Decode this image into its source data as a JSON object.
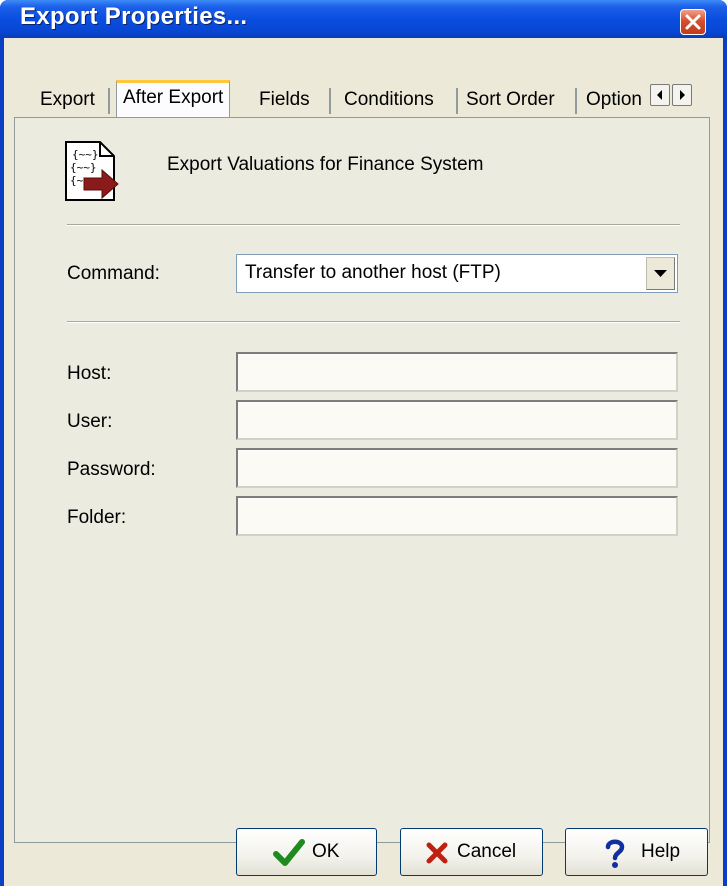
{
  "window": {
    "title": "Export Properties..."
  },
  "tabs": [
    "Export",
    "After Export",
    "Fields",
    "Conditions",
    "Sort Order",
    "Option"
  ],
  "active_tab": "After Export",
  "description": "Export Valuations for Finance System",
  "command": {
    "label": "Command:",
    "value": "Transfer to another host (FTP)"
  },
  "fields": {
    "host": {
      "label": "Host:",
      "value": ""
    },
    "user": {
      "label": "User:",
      "value": ""
    },
    "password": {
      "label": "Password:",
      "value": ""
    },
    "folder": {
      "label": "Folder:",
      "value": ""
    }
  },
  "buttons": {
    "ok": "OK",
    "cancel": "Cancel",
    "help": "Help"
  },
  "icons": [
    "close-icon",
    "document-export-icon",
    "chevron-down-icon",
    "scroll-left-icon",
    "scroll-right-icon",
    "checkmark-icon",
    "x-icon",
    "question-icon"
  ],
  "colors": {
    "titlebar": "#0a4ee0",
    "dialog_bg": "#ece9d8",
    "ok_check": "#1f8a1f",
    "cancel_x": "#c02010",
    "help_q": "#1030a0"
  }
}
